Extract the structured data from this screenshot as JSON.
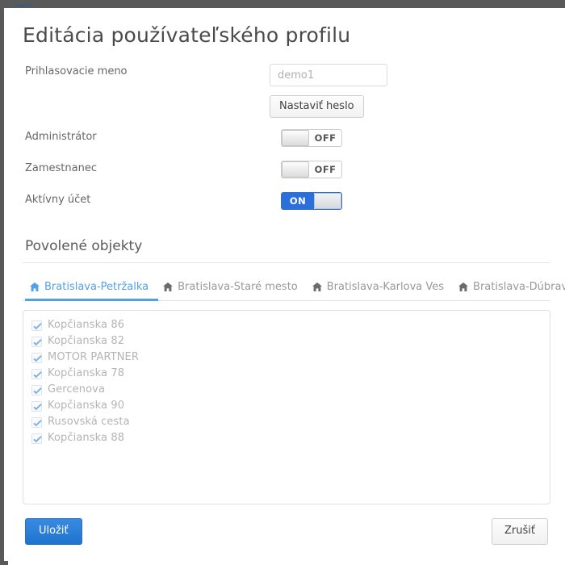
{
  "window": {
    "frame_color": "#595959"
  },
  "page": {
    "title": "Editácia používateľského profilu"
  },
  "form": {
    "rows": [
      {
        "label": "Prihlasovacie meno"
      },
      {
        "label": ""
      },
      {
        "label": "Administrátor"
      },
      {
        "label": "Zamestnanec"
      },
      {
        "label": "Aktívny účet"
      }
    ],
    "username_field": {
      "label": "Prihlasovacie meno",
      "value": "",
      "placeholder": "demo1"
    },
    "set_password_button": {
      "label": "Nastaviť heslo"
    },
    "toggles": [
      {
        "label": "Administrátor",
        "state": "OFF",
        "on": false
      },
      {
        "label": "Zamestnanec",
        "state": "OFF",
        "on": false
      },
      {
        "label": "Aktívny účet",
        "state": "ON",
        "on": true
      }
    ]
  },
  "section": {
    "heading": "Povolené objekty"
  },
  "tabs": [
    {
      "label": "Bratislava-Petržalka",
      "icon": "home-icon",
      "active": true
    },
    {
      "label": "Bratislava-Staré mesto",
      "icon": "home-icon",
      "active": false
    },
    {
      "label": "Bratislava-Karlova Ves",
      "icon": "home-icon",
      "active": false
    },
    {
      "label": "Bratislava-Dúbravka",
      "icon": "home-icon",
      "active": false
    }
  ],
  "object_list": [
    {
      "label": "Kopčianska 86",
      "checked": true
    },
    {
      "label": "Kopčianska 82",
      "checked": true
    },
    {
      "label": "MOTOR PARTNER",
      "checked": true
    },
    {
      "label": "Kopčianska 78",
      "checked": true
    },
    {
      "label": "Gercenova",
      "checked": true
    },
    {
      "label": "Kopčianska 90",
      "checked": true
    },
    {
      "label": "Rusovská cesta",
      "checked": true
    },
    {
      "label": "Kopčianska 88",
      "checked": true
    }
  ],
  "footer": {
    "save_label": "Uložiť",
    "cancel_label": "Zrušiť"
  },
  "colors": {
    "accent_blue": "#2a6fdb",
    "tab_active": "#52a0e8",
    "save_button": "#2b7ed6",
    "muted_text": "#b4b4b4",
    "frame": "#595959"
  }
}
